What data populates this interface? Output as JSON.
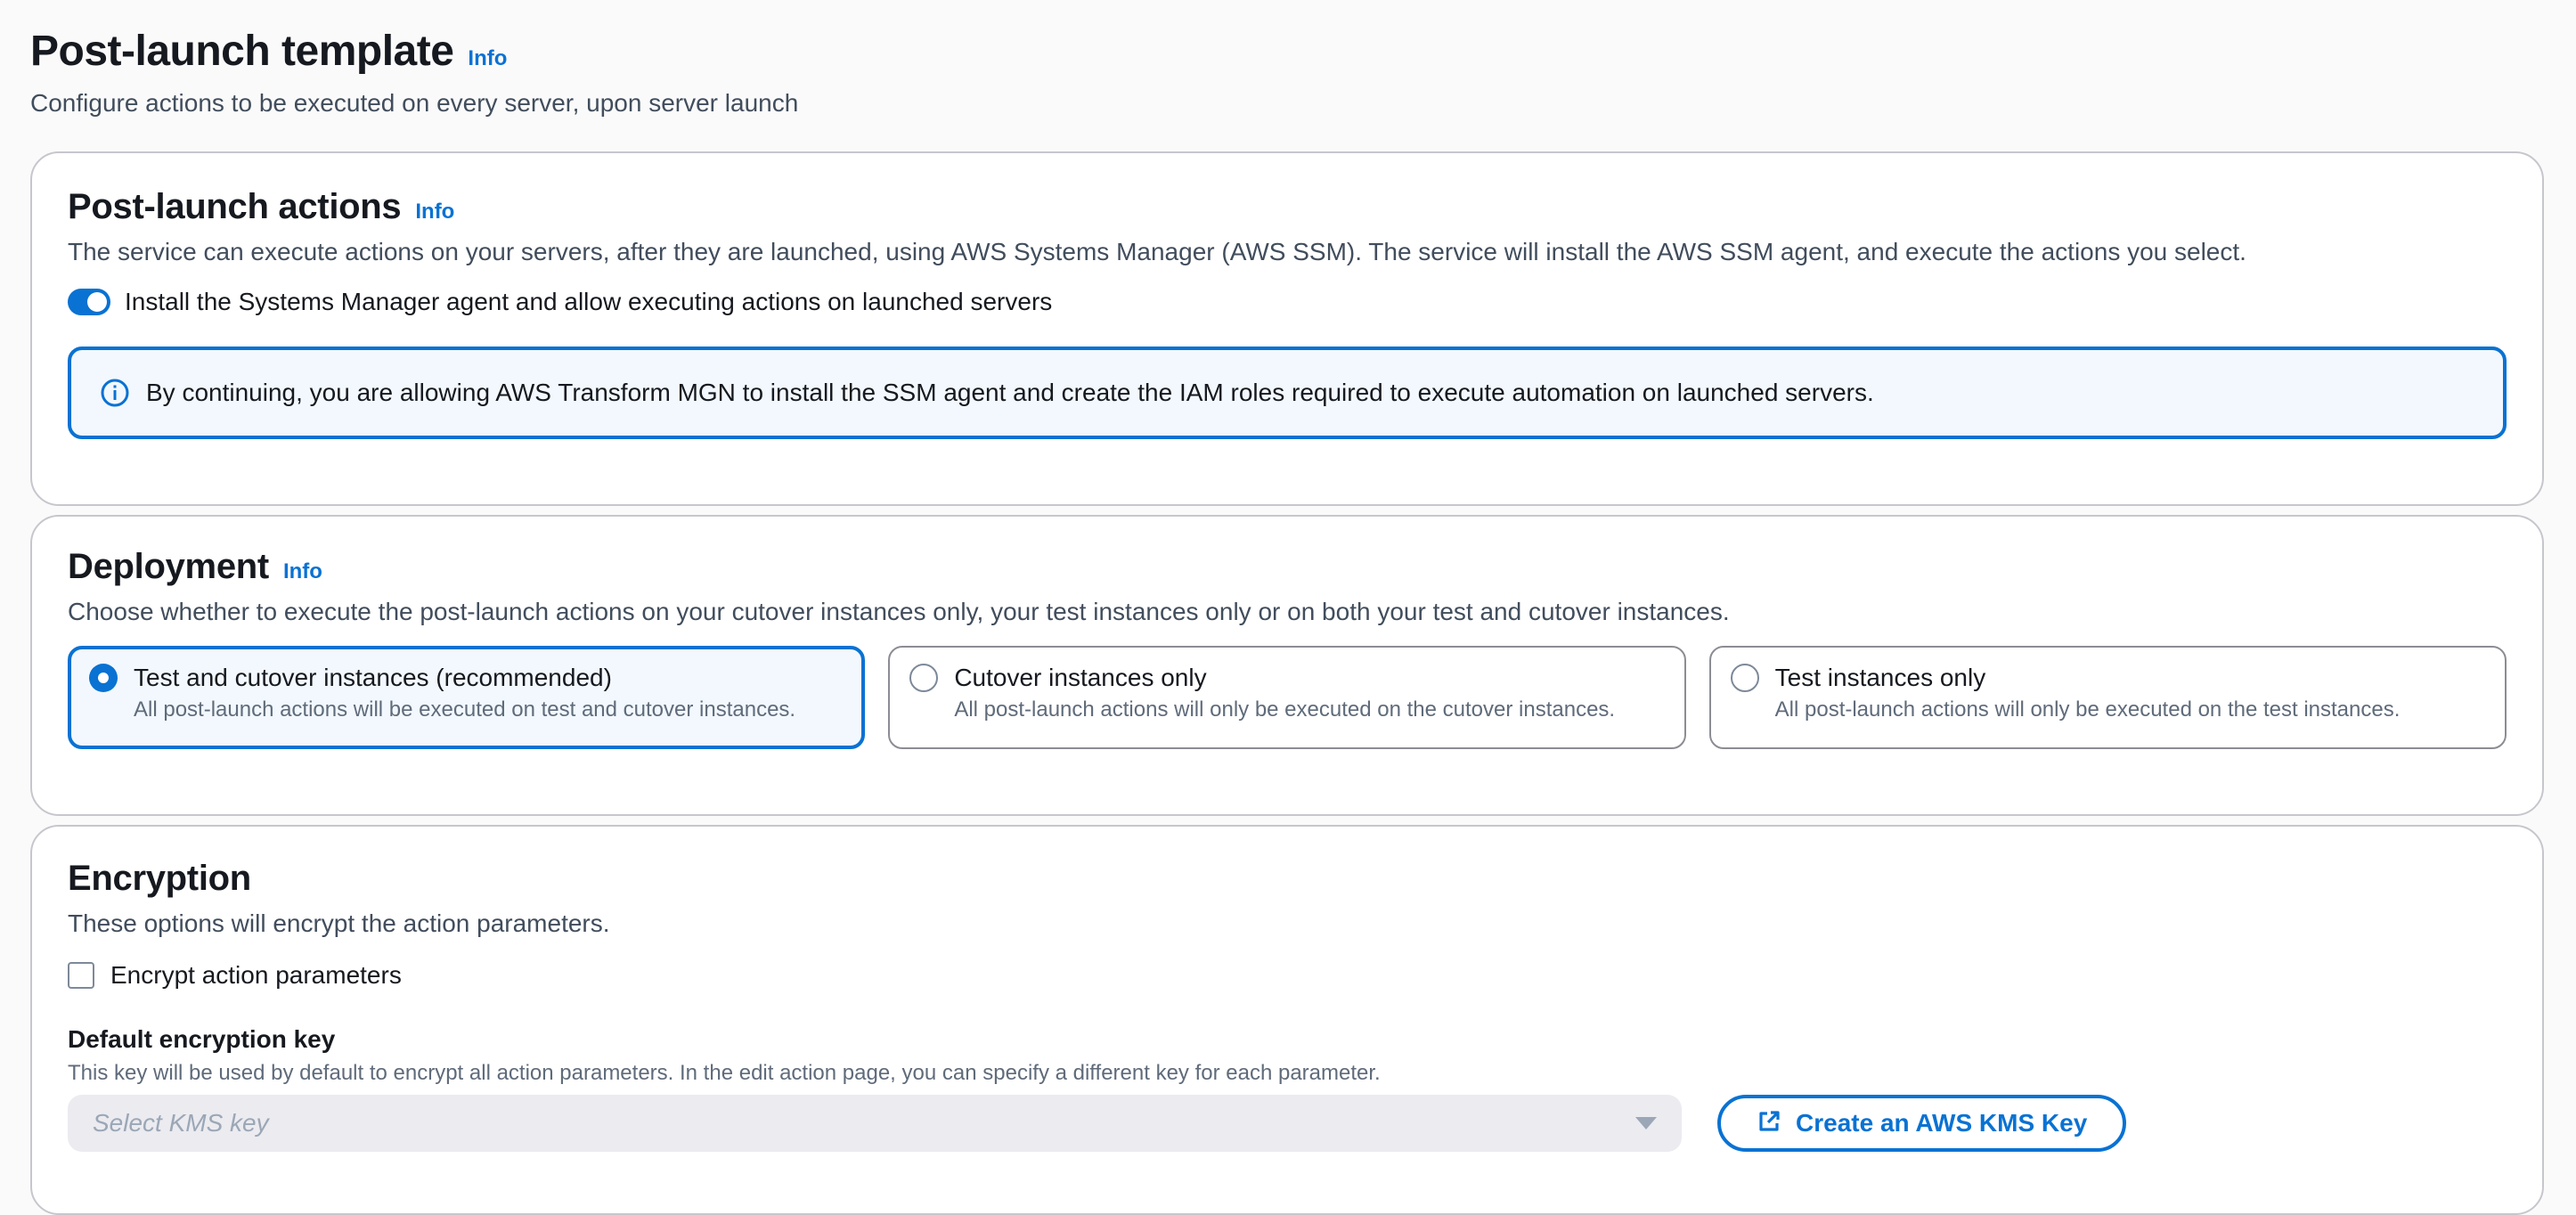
{
  "header": {
    "title": "Post-launch template",
    "info": "Info",
    "description": "Configure actions to be executed on every server, upon server launch"
  },
  "post_launch_actions": {
    "title": "Post-launch actions",
    "info": "Info",
    "description": "The service can execute actions on your servers, after they are launched, using AWS Systems Manager (AWS SSM). The service will install the AWS SSM agent, and execute the actions you select.",
    "toggle_label": "Install the Systems Manager agent and allow executing actions on launched servers",
    "toggle_on": true,
    "alert_text": "By continuing, you are allowing AWS Transform MGN to install the SSM agent and create the IAM roles required to execute automation on launched servers."
  },
  "deployment": {
    "title": "Deployment",
    "info": "Info",
    "description": "Choose whether to execute the post-launch actions on your cutover instances only, your test instances only or on both your test and cutover instances.",
    "options": [
      {
        "title": "Test and cutover instances (recommended)",
        "description": "All post-launch actions will be executed on test and cutover instances.",
        "selected": true
      },
      {
        "title": "Cutover instances only",
        "description": "All post-launch actions will only be executed on the cutover instances.",
        "selected": false
      },
      {
        "title": "Test instances only",
        "description": "All post-launch actions will only be executed on the test instances.",
        "selected": false
      }
    ]
  },
  "encryption": {
    "title": "Encryption",
    "description": "These options will encrypt the action parameters.",
    "checkbox_label": "Encrypt action parameters",
    "checkbox_checked": false,
    "key_label": "Default encryption key",
    "key_description": "This key will be used by default to encrypt all action parameters. In the edit action page, you can specify a different key for each parameter.",
    "select_placeholder": "Select KMS key",
    "create_button": "Create an AWS KMS Key"
  },
  "colors": {
    "accent": "#0972d3",
    "alert_bg": "#f2f8fd",
    "border": "#c6c6cd"
  }
}
